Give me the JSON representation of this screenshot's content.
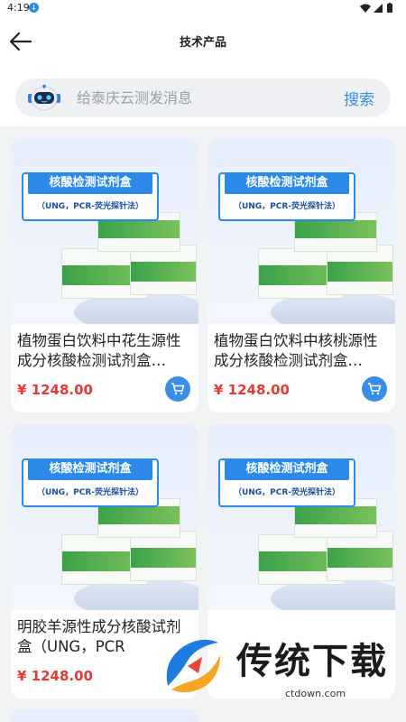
{
  "status_bar": {
    "time": "4:19",
    "notification": "↓"
  },
  "header": {
    "title": "技术产品"
  },
  "search": {
    "placeholder": "给泰庆云测发消息",
    "button_label": "搜索"
  },
  "product_image": {
    "banner_title": "核酸检测试剂盒",
    "banner_subtitle": "（UNG，PCR-荧光探针法）"
  },
  "products": [
    {
      "name": "植物蛋白饮料中花生源性成分核酸检测试剂盒…",
      "price": "¥ 1248.00"
    },
    {
      "name": "植物蛋白饮料中核桃源性成分核酸检测试剂盒…",
      "price": "¥ 1248.00"
    },
    {
      "name": "明胶羊源性成分核酸试剂盒（UNG，PCR",
      "price": "¥ 1248.00"
    },
    {
      "name": "",
      "price": ""
    }
  ],
  "watermark": {
    "text": "传统下载",
    "url": "ctdown.com"
  },
  "colors": {
    "accent": "#3a8ee6",
    "price": "#e53935",
    "background": "#f2f3f5"
  }
}
